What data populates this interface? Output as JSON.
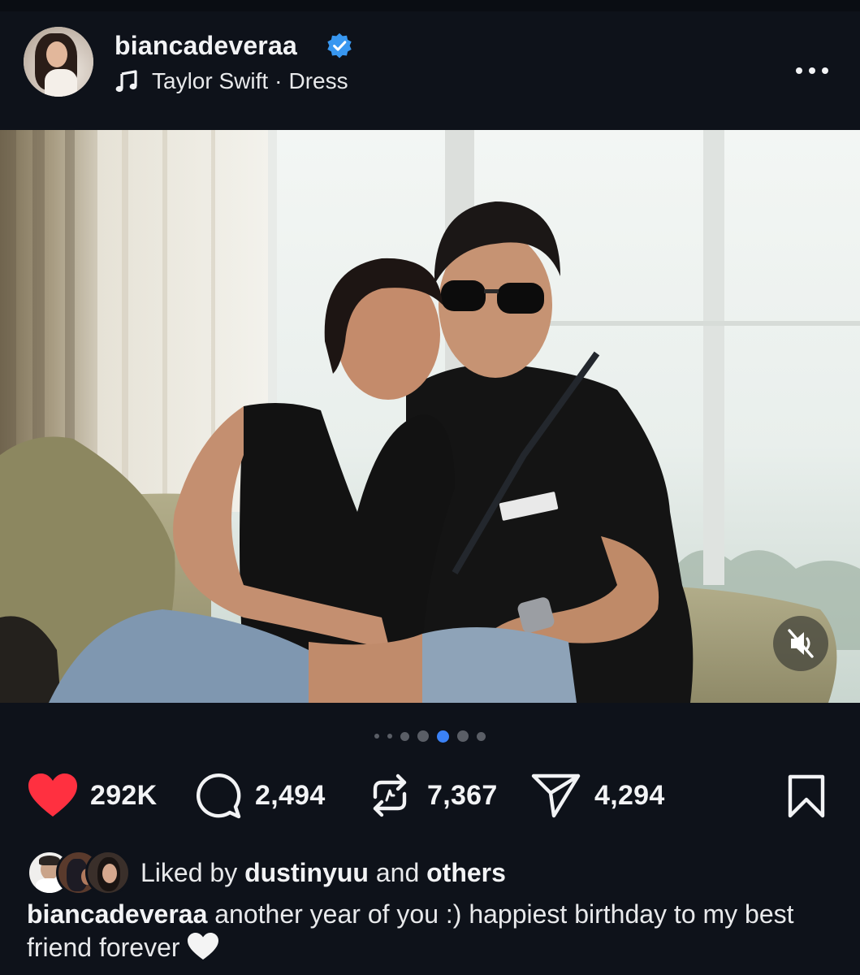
{
  "post": {
    "username": "biancadeveraa",
    "verified": true,
    "music": {
      "artist": "Taylor Swift",
      "separator": "·",
      "song": "Dress"
    }
  },
  "carousel": {
    "total": 7,
    "active_index": 4
  },
  "actions": {
    "likes": "292K",
    "comments": "2,494",
    "reposts": "7,367",
    "shares": "4,294"
  },
  "liked_by": {
    "prefix": "Liked by",
    "user": "dustinyuu",
    "conjunction": "and",
    "suffix": "others"
  },
  "caption": {
    "username": "biancadeveraa",
    "text": "another year of you :) happiest birthday to my best friend forever",
    "emoji": "white-heart"
  },
  "colors": {
    "background": "#0e121a",
    "like_red": "#ff3040",
    "verified_blue": "#3897f0",
    "active_dot": "#3b82f6"
  },
  "icons": [
    "music-note-icon",
    "more-icon",
    "mute-icon",
    "heart-icon",
    "comment-icon",
    "repost-icon",
    "share-icon",
    "bookmark-icon",
    "verified-badge-icon"
  ]
}
